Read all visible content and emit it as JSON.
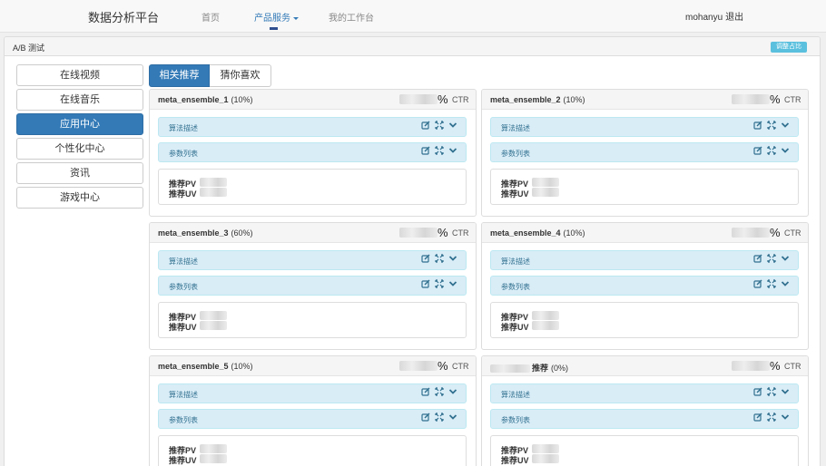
{
  "header": {
    "brand": "数据分析平台",
    "nav": [
      {
        "label": "首页"
      },
      {
        "label": "产品服务"
      },
      {
        "label": "我的工作台"
      }
    ],
    "user": "mohanyu",
    "logout": "退出"
  },
  "panel": {
    "title": "A/B 测试",
    "adjust_button": "调整占比"
  },
  "sidebar": {
    "items": [
      {
        "label": "在线视频"
      },
      {
        "label": "在线音乐"
      },
      {
        "label": "应用中心",
        "active": true
      },
      {
        "label": "个性化中心"
      },
      {
        "label": "资讯"
      },
      {
        "label": "游戏中心"
      }
    ]
  },
  "tabs": [
    {
      "label": "相关推荐",
      "active": true
    },
    {
      "label": "猜你喜欢",
      "active": false
    }
  ],
  "labels": {
    "ctr_symbol": "%",
    "ctr_label": "CTR",
    "accordion_desc": "算法描述",
    "accordion_params": "参数列表",
    "pv_label": "推荐PV",
    "uv_label": "推荐UV"
  },
  "cards": [
    {
      "name": "meta_ensemble_1",
      "pct": "(10%)"
    },
    {
      "name": "meta_ensemble_2",
      "pct": "(10%)"
    },
    {
      "name": "meta_ensemble_3",
      "pct": "(60%)"
    },
    {
      "name": "meta_ensemble_4",
      "pct": "(10%)"
    },
    {
      "name": "meta_ensemble_5",
      "pct": "(10%)"
    },
    {
      "name": "推荐",
      "pct": "(0%)"
    }
  ],
  "colors": {
    "primary": "#337ab7",
    "info_bg": "#d9edf7",
    "info_text": "#31708f",
    "adjust_button": "#5bc0de"
  },
  "icons": [
    "edit-icon",
    "expand-icon",
    "chevron-down-icon"
  ]
}
